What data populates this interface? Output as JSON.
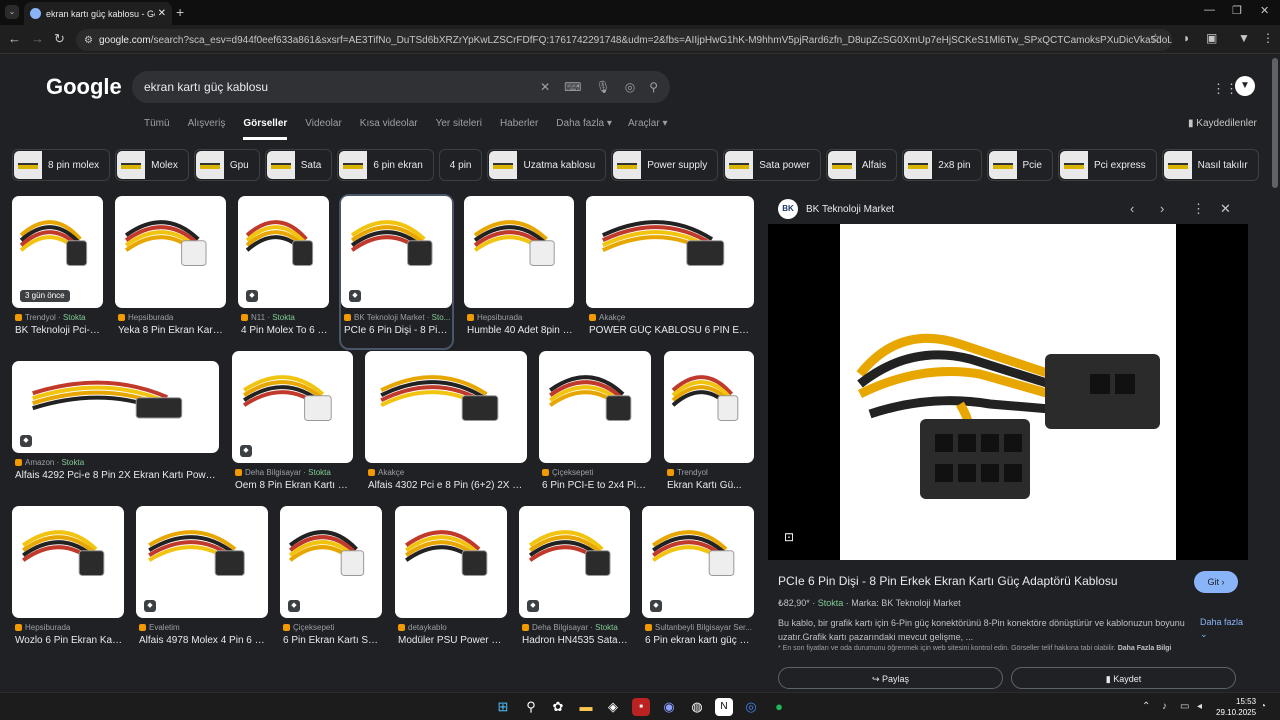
{
  "browser": {
    "tab_title": "ekran kartı güç kablosu - Goog",
    "new_tab_glyph": "+",
    "url_host": "google.com",
    "url_path": "/search?sca_esv=d944f0eef633a861&sxsrf=AE3TifNo_DuTSd6bXRZrYpKwLZSCrFDfFQ:1761742291748&udm=2&fbs=AIIjpHwG1hK-M9hhmV5pjRard6zfn_D8upZcSG0XmUp7eHjSCKeS1Ml6Tw_SPxQCTCamoksPXuDicVka5doLYNNSOkQLRK3qHiR3QNXpEkpoJ2..."
  },
  "google": {
    "logo": "Google",
    "query": "ekran kartı güç kablosu",
    "nav_tabs": [
      "Tümü",
      "Alışveriş",
      "Görseller",
      "Videolar",
      "Kısa videolar",
      "Yer siteleri",
      "Haberler",
      "Daha fazla ▾"
    ],
    "tools": "Araçlar ▾",
    "saved": "Kaydedilenler",
    "chips": [
      {
        "label": "8 pin molex",
        "img": true
      },
      {
        "label": "Molex",
        "img": true
      },
      {
        "label": "Gpu",
        "img": true
      },
      {
        "label": "Sata",
        "img": true
      },
      {
        "label": "6 pin ekran",
        "img": true
      },
      {
        "label": "4 pin",
        "img": false
      },
      {
        "label": "Uzatma kablosu",
        "img": true
      },
      {
        "label": "Power supply",
        "img": true
      },
      {
        "label": "Sata power",
        "img": true
      },
      {
        "label": "Alfais",
        "img": true
      },
      {
        "label": "2x8 pin",
        "img": true
      },
      {
        "label": "Pcie",
        "img": true
      },
      {
        "label": "Pci express",
        "img": true
      },
      {
        "label": "Nasıl takılır",
        "img": true
      }
    ],
    "results": [
      {
        "source": "Trendyol",
        "stock": "Stokta",
        "title": "BK Teknoloji Pci-e ...",
        "badge": "3 gün önce"
      },
      {
        "source": "Hepsiburada",
        "stock": "",
        "title": "Yeka 8 Pin Ekran Kartı ...",
        "badge": ""
      },
      {
        "source": "N11",
        "stock": "Stokta",
        "title": "4 Pin Molex To 6 P...",
        "badge": "tag"
      },
      {
        "source": "BK Teknoloji Market",
        "stock": "Sto...",
        "title": "PCIe 6 Pin Dişi - 8 Pin ...",
        "badge": "tag"
      },
      {
        "source": "Hepsiburada",
        "stock": "",
        "title": "Humble 40 Adet 8pin - ...",
        "badge": ""
      },
      {
        "source": "Akakçe",
        "stock": "",
        "title": "POWER GÜÇ KABLOSU 6 PİN EKRA...",
        "badge": ""
      },
      {
        "source": "Amazon",
        "stock": "Stokta",
        "title": "Alfais 4292 Pci-e 8 Pin 2X Ekran Kartı Power G...",
        "badge": "tag"
      },
      {
        "source": "Deha Bilgisayar",
        "stock": "Stokta",
        "title": "Oem 8 Pin Ekran Kartı Gü...",
        "badge": "tag"
      },
      {
        "source": "Akakçe",
        "stock": "",
        "title": "Alfais 4302 Pci e 8 Pin (6+2) 2X Pci-...",
        "badge": ""
      },
      {
        "source": "Çiçeksepeti",
        "stock": "",
        "title": "6 Pin PCI-E to 2x4 Pin ...",
        "badge": ""
      },
      {
        "source": "Trendyol",
        "stock": "",
        "title": "Ekran Kartı Gü...",
        "badge": ""
      },
      {
        "source": "Hepsiburada",
        "stock": "",
        "title": "Wozlo 6 Pin Ekran Kartı...",
        "badge": ""
      },
      {
        "source": "Evaletim",
        "stock": "",
        "title": "Alfais 4978 Molex 4 Pin 6 Pi...",
        "badge": "tag"
      },
      {
        "source": "Çiçeksepeti",
        "stock": "",
        "title": "6 Pin Ekran Kartı Sat...",
        "badge": "tag"
      },
      {
        "source": "detaykablo",
        "stock": "",
        "title": "Modüler PSU Power Ka...",
        "badge": ""
      },
      {
        "source": "Deha Bilgisayar",
        "stock": "Stokta",
        "title": "Hadron HN4535 Sata El...",
        "badge": "tag"
      },
      {
        "source": "Sultanbeyli Bilgisayar Ser...",
        "stock": "",
        "title": "6 Pin ekran kartı güç ka...",
        "badge": "tag"
      }
    ]
  },
  "panel": {
    "site": "BK Teknoloji Market",
    "logo_text": "BK",
    "title": "PCIe 6 Pin Dişi - 8 Pin Erkek Ekran Kartı Güç Adaptörü Kablosu",
    "visit": "Git ›",
    "price": "₺82,90*",
    "stock": "Stokta",
    "brand": "· Marka: BK Teknoloji Market",
    "description": "Bu kablo, bir grafik kartı için 6-Pin güç konektörünü 8-Pin konektöre dönüştürür ve kablonuzun boyunu uzatır.Grafik kartı pazarındaki mevcut gelişme, ...",
    "more": "Daha fazla",
    "note": "* En son fiyatları ve oda durumunu öğrenmek için web sitesini kontrol edin. Görseller telif hakkına tabi olabilir.",
    "note_link": "Daha Fazla Bilgi",
    "share": "Paylaş",
    "save": "Kaydet"
  },
  "taskbar": {
    "time": "15:53",
    "date": "29.10.2025"
  }
}
